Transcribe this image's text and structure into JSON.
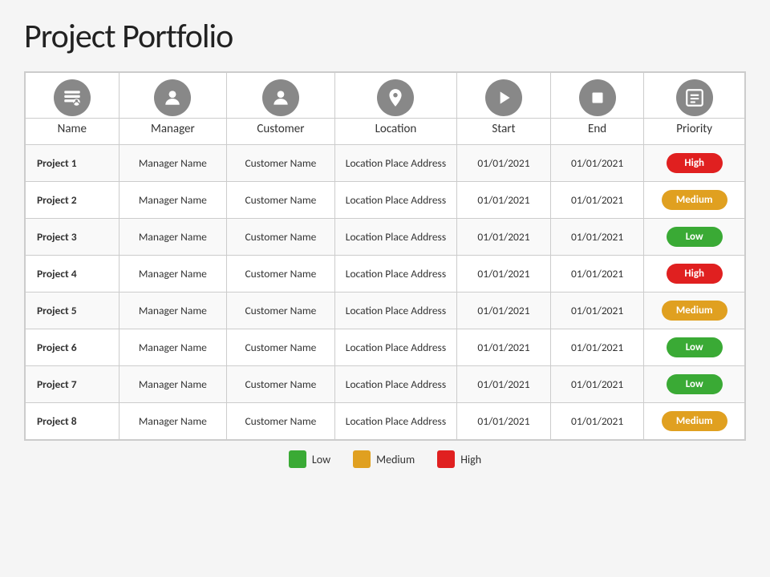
{
  "title": "Project Portfolio",
  "columns": [
    {
      "key": "name",
      "label": "Name",
      "icon": "👤"
    },
    {
      "key": "manager",
      "label": "Manager",
      "icon": "👷"
    },
    {
      "key": "customer",
      "label": "Customer",
      "icon": "🧑"
    },
    {
      "key": "location",
      "label": "Location",
      "icon": "📍"
    },
    {
      "key": "start",
      "label": "Start",
      "icon": "▶"
    },
    {
      "key": "end",
      "label": "End",
      "icon": "⏹"
    },
    {
      "key": "priority",
      "label": "Priority",
      "icon": "📋"
    }
  ],
  "rows": [
    {
      "name": "Project 1",
      "manager": "Manager Name",
      "customer": "Customer  Name",
      "location": "Location Place Address",
      "start": "01/01/2021",
      "end": "01/01/2021",
      "priority": "High"
    },
    {
      "name": "Project 2",
      "manager": "Manager Name",
      "customer": "Customer  Name",
      "location": "Location Place Address",
      "start": "01/01/2021",
      "end": "01/01/2021",
      "priority": "Medium"
    },
    {
      "name": "Project 3",
      "manager": "Manager Name",
      "customer": "Customer  Name",
      "location": "Location Place Address",
      "start": "01/01/2021",
      "end": "01/01/2021",
      "priority": "Low"
    },
    {
      "name": "Project 4",
      "manager": "Manager Name",
      "customer": "Customer  Name",
      "location": "Location Place Address",
      "start": "01/01/2021",
      "end": "01/01/2021",
      "priority": "High"
    },
    {
      "name": "Project 5",
      "manager": "Manager Name",
      "customer": "Customer  Name",
      "location": "Location Place Address",
      "start": "01/01/2021",
      "end": "01/01/2021",
      "priority": "Medium"
    },
    {
      "name": "Project 6",
      "manager": "Manager Name",
      "customer": "Customer  Name",
      "location": "Location Place Address",
      "start": "01/01/2021",
      "end": "01/01/2021",
      "priority": "Low"
    },
    {
      "name": "Project 7",
      "manager": "Manager Name",
      "customer": "Customer  Name",
      "location": "Location Place Address",
      "start": "01/01/2021",
      "end": "01/01/2021",
      "priority": "Low"
    },
    {
      "name": "Project 8",
      "manager": "Manager Name",
      "customer": "Customer  Name",
      "location": "Location Place Address",
      "start": "01/01/2021",
      "end": "01/01/2021",
      "priority": "Medium"
    }
  ],
  "legend": [
    {
      "label": "Low",
      "color": "low"
    },
    {
      "label": "Medium",
      "color": "medium"
    },
    {
      "label": "High",
      "color": "high"
    }
  ],
  "icons": {
    "name": "🪪",
    "manager": "👷",
    "customer": "🧑",
    "location": "📍",
    "start": "▶",
    "end": "⏹",
    "priority": "📋"
  }
}
